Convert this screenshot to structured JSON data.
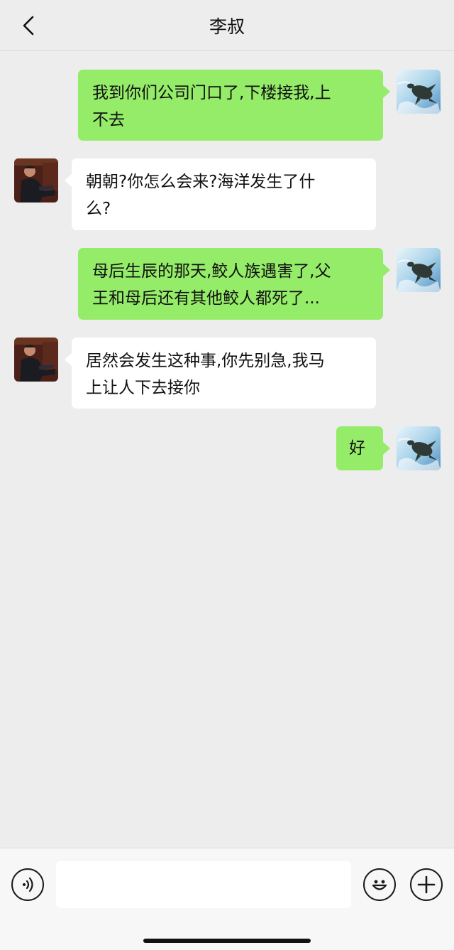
{
  "header": {
    "title": "李叔",
    "back_icon": "chevron-left-icon"
  },
  "messages": [
    {
      "side": "right",
      "text_lines": [
        "我到你们公司门口了,下楼接我,上",
        "不去"
      ],
      "avatar": "sea-turtle-avatar"
    },
    {
      "side": "left",
      "text_lines": [
        "朝朝?你怎么会来?海洋发生了什",
        "么?"
      ],
      "avatar": "man-portrait-avatar"
    },
    {
      "side": "right",
      "text_lines": [
        "母后生辰的那天,鲛人族遇害了,父",
        "王和母后还有其他鲛人都死了..."
      ],
      "avatar": "sea-turtle-avatar"
    },
    {
      "side": "left",
      "text_lines": [
        "居然会发生这种事,你先别急,我马",
        "上让人下去接你"
      ],
      "avatar": "man-portrait-avatar"
    },
    {
      "side": "right",
      "text_lines": [
        "好"
      ],
      "avatar": "sea-turtle-avatar"
    }
  ],
  "input_bar": {
    "voice_icon": "voice-icon",
    "text_value": "",
    "emoji_icon": "emoji-icon",
    "plus_icon": "plus-icon"
  },
  "colors": {
    "background": "#ededed",
    "sent_bubble": "#95ec69",
    "received_bubble": "#ffffff"
  }
}
